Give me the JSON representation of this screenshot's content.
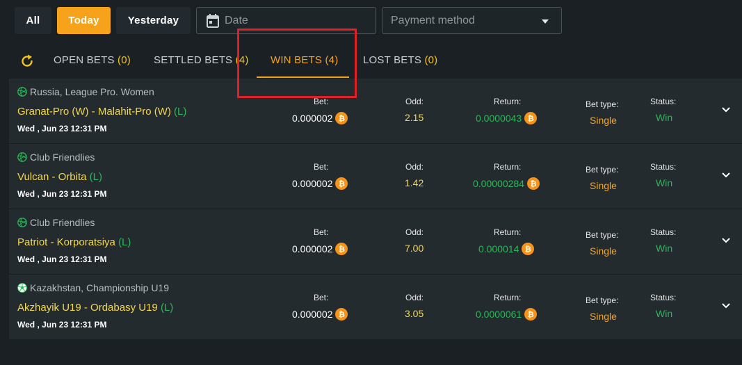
{
  "filters": {
    "buttons": [
      "All",
      "Today",
      "Yesterday"
    ],
    "active": "Today",
    "date_placeholder": "Date",
    "payment_placeholder": "Payment method",
    "accent_color": "#f7a21b"
  },
  "tabs": [
    {
      "label": "OPEN BETS",
      "count": "(0)"
    },
    {
      "label": "SETTLED BETS",
      "count": "(4)"
    },
    {
      "label": "WIN BETS",
      "count": "(4)",
      "active": true
    },
    {
      "label": "LOST BETS",
      "count": "(0)"
    }
  ],
  "labels": {
    "bet": "Bet:",
    "odd": "Odd:",
    "return": "Return:",
    "bet_type": "Bet type:",
    "status": "Status:",
    "live_marker": "(L)",
    "btc_symbol": "₿"
  },
  "bets": [
    {
      "league": "Russia, League Pro. Women",
      "match": "Granat-Pro (W) - Malahit-Pro (W)",
      "datetime": "Wed , Jun 23 12:31 PM",
      "bet": "0.000002",
      "odd": "2.15",
      "return": "0.0000043",
      "bet_type": "Single",
      "status": "Win",
      "icon": "volleyball-icon"
    },
    {
      "league": "Club Friendlies",
      "match": "Vulcan - Orbita",
      "datetime": "Wed , Jun 23 12:31 PM",
      "bet": "0.000002",
      "odd": "1.42",
      "return": "0.00000284",
      "bet_type": "Single",
      "status": "Win",
      "icon": "volleyball-icon"
    },
    {
      "league": "Club Friendlies",
      "match": "Patriot - Korporatsiya",
      "datetime": "Wed , Jun 23 12:31 PM",
      "bet": "0.000002",
      "odd": "7.00",
      "return": "0.000014",
      "bet_type": "Single",
      "status": "Win",
      "icon": "volleyball-icon"
    },
    {
      "league": "Kazakhstan, Championship U19",
      "match": "Akzhayik U19 - Ordabasy U19",
      "datetime": "Wed , Jun 23 12:31 PM",
      "bet": "0.000002",
      "odd": "3.05",
      "return": "0.0000061",
      "bet_type": "Single",
      "status": "Win",
      "icon": "soccer-ball-icon"
    }
  ]
}
